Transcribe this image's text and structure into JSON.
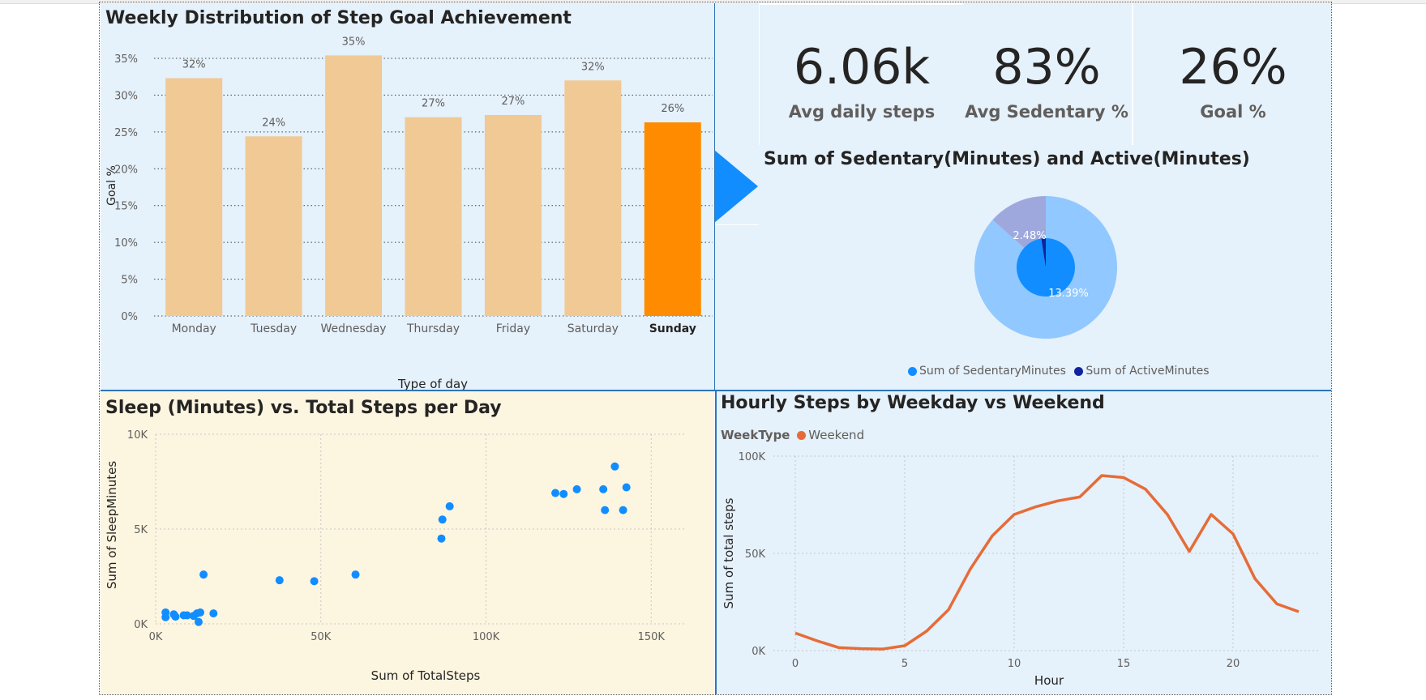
{
  "colors": {
    "bar": "#f0c994",
    "bar_highlight": "#ff8c00",
    "scatter": "#118dff",
    "line": "#e66c37",
    "pie_outer_main": "#91c8ff",
    "pie_outer_other": "#9ea8dd",
    "pie_inner_main": "#118dff",
    "pie_inner_other": "#12239e"
  },
  "bar_panel": {
    "title": "Weekly Distribution of Step Goal Achievement"
  },
  "kpis": [
    {
      "value": "6.06k",
      "label": "Avg daily steps"
    },
    {
      "value": "83%",
      "label": "Avg Sedentary %"
    },
    {
      "value": "26%",
      "label": "Goal %"
    }
  ],
  "pie_panel": {
    "title": "Sum of Sedentary(Minutes) and Active(Minutes)"
  },
  "scatter_panel": {
    "title": "Sleep (Minutes) vs. Total Steps per Day"
  },
  "line_panel": {
    "title": "Hourly Steps by Weekday vs Weekend"
  },
  "chart_data": [
    {
      "type": "bar",
      "title": "Weekly Distribution of Step Goal Achievement",
      "xlabel": "Type of day",
      "ylabel": "Goal %",
      "categories": [
        "Monday",
        "Tuesday",
        "Wednesday",
        "Thursday",
        "Friday",
        "Saturday",
        "Sunday"
      ],
      "values": [
        32.3,
        24.4,
        35.4,
        27.0,
        27.3,
        32.0,
        26.3
      ],
      "data_labels": [
        "32%",
        "24%",
        "35%",
        "27%",
        "27%",
        "32%",
        "26%"
      ],
      "highlighted": "Sunday",
      "ylim": [
        0,
        35
      ],
      "yticks": [
        "0%",
        "5%",
        "10%",
        "15%",
        "20%",
        "25%",
        "30%",
        "35%"
      ],
      "grid": true
    },
    {
      "type": "pie",
      "title": "Sum of Sedentary(Minutes) and Active(Minutes)",
      "rings": [
        {
          "slices": [
            {
              "name": "Sum of SedentaryMinutes",
              "value": 86.61
            },
            {
              "name": "Sum of ActiveMinutes",
              "value": 13.39,
              "label": "13.39%"
            }
          ]
        },
        {
          "slices": [
            {
              "name": "Sum of SedentaryMinutes",
              "value": 97.52
            },
            {
              "name": "Sum of ActiveMinutes",
              "value": 2.48,
              "label": "2.48%"
            }
          ]
        }
      ],
      "legend": [
        "Sum of SedentaryMinutes",
        "Sum of ActiveMinutes"
      ],
      "legend_position": "bottom"
    },
    {
      "type": "scatter",
      "title": "Sleep (Minutes) vs. Total Steps per Day",
      "xlabel": "Sum of TotalSteps",
      "ylabel": "Sum of SleepMinutes",
      "xlim": [
        0,
        160000
      ],
      "ylim": [
        0,
        10000
      ],
      "xticks": [
        {
          "v": 0,
          "label": "0K"
        },
        {
          "v": 50000,
          "label": "50K"
        },
        {
          "v": 100000,
          "label": "100K"
        },
        {
          "v": 150000,
          "label": "150K"
        }
      ],
      "yticks": [
        {
          "v": 0,
          "label": "0K"
        },
        {
          "v": 5000,
          "label": "5K"
        },
        {
          "v": 10000,
          "label": "10K"
        }
      ],
      "points": [
        [
          3000,
          600
        ],
        [
          3000,
          350
        ],
        [
          5500,
          500
        ],
        [
          6000,
          380
        ],
        [
          8500,
          450
        ],
        [
          9500,
          450
        ],
        [
          11500,
          420
        ],
        [
          12500,
          550
        ],
        [
          13500,
          600
        ],
        [
          13000,
          100
        ],
        [
          14500,
          2600
        ],
        [
          17500,
          550
        ],
        [
          37500,
          2300
        ],
        [
          48000,
          2250
        ],
        [
          60500,
          2600
        ],
        [
          86500,
          4500
        ],
        [
          86800,
          5500
        ],
        [
          89000,
          6200
        ],
        [
          121000,
          6900
        ],
        [
          123500,
          6850
        ],
        [
          127500,
          7100
        ],
        [
          135500,
          7100
        ],
        [
          136000,
          6000
        ],
        [
          139000,
          8300
        ],
        [
          141500,
          6000
        ],
        [
          142500,
          7200
        ]
      ],
      "grid": true
    },
    {
      "type": "line",
      "title": "Hourly Steps by Weekday vs Weekend",
      "xlabel": "Hour",
      "ylabel": "Sum of total steps",
      "legend_title": "WeekType",
      "series": [
        {
          "name": "Weekend",
          "x": [
            0,
            1,
            2,
            3,
            4,
            5,
            6,
            7,
            8,
            9,
            10,
            11,
            12,
            13,
            14,
            15,
            16,
            17,
            18,
            19,
            20,
            21,
            22,
            23
          ],
          "values": [
            9000,
            5000,
            1500,
            1000,
            800,
            2500,
            10000,
            21000,
            42000,
            59000,
            70000,
            74000,
            77000,
            79000,
            90000,
            89000,
            83000,
            70000,
            51000,
            70000,
            60000,
            37000,
            24000,
            20000
          ]
        }
      ],
      "xlim": [
        -1,
        24
      ],
      "ylim": [
        0,
        100000
      ],
      "xticks": [
        {
          "v": 0,
          "label": "0"
        },
        {
          "v": 5,
          "label": "5"
        },
        {
          "v": 10,
          "label": "10"
        },
        {
          "v": 15,
          "label": "15"
        },
        {
          "v": 20,
          "label": "20"
        }
      ],
      "yticks": [
        {
          "v": 0,
          "label": "0K"
        },
        {
          "v": 50000,
          "label": "50K"
        },
        {
          "v": 100000,
          "label": "100K"
        }
      ],
      "grid": true
    }
  ]
}
